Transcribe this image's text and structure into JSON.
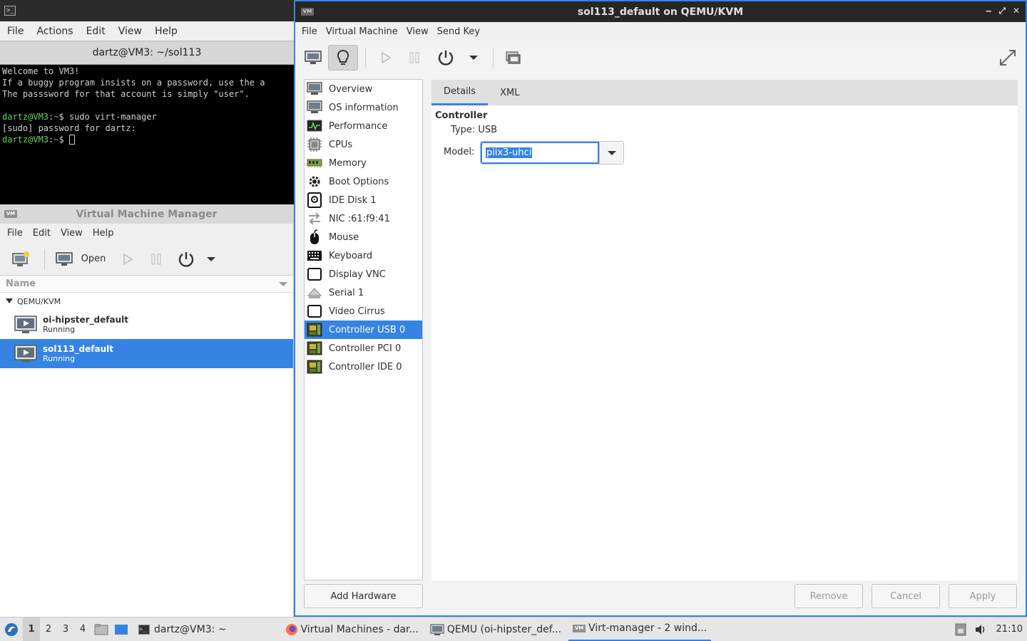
{
  "terminal": {
    "menu": [
      "File",
      "Actions",
      "Edit",
      "View",
      "Help"
    ],
    "tab_title": "dartz@VM3: ~/sol113",
    "lines": {
      "l1": "Welcome to VM3!",
      "l2": "If a buggy program insists on a password, use the a",
      "l3": "The passsword for that account is simply \"user\".",
      "prompt_user": "dartz@VM3",
      "prompt_sep": ":",
      "prompt_path": "~",
      "prompt_end": "$ ",
      "cmd1": "sudo virt-manager",
      "l5": "[sudo] password for dartz:"
    }
  },
  "vmm": {
    "title": "Virtual Machine Manager",
    "logo": "VM",
    "menu": [
      "File",
      "Edit",
      "View",
      "Help"
    ],
    "toolbar": {
      "open_label": "Open"
    },
    "column_name": "Name",
    "group": "QEMU/KVM",
    "vms": [
      {
        "name": "oi-hipster_default",
        "status": "Running"
      },
      {
        "name": "sol113_default",
        "status": "Running"
      }
    ]
  },
  "details": {
    "title": "sol113_default on QEMU/KVM",
    "menu": [
      "File",
      "Virtual Machine",
      "View",
      "Send Key"
    ],
    "hardware": [
      {
        "label": "Overview",
        "icon": "monitor-icon"
      },
      {
        "label": "OS information",
        "icon": "monitor-icon"
      },
      {
        "label": "Performance",
        "icon": "performance-icon"
      },
      {
        "label": "CPUs",
        "icon": "cpu-icon"
      },
      {
        "label": "Memory",
        "icon": "memory-icon"
      },
      {
        "label": "Boot Options",
        "icon": "gear-icon"
      },
      {
        "label": "IDE Disk 1",
        "icon": "disk-icon"
      },
      {
        "label": "NIC :61:f9:41",
        "icon": "network-icon"
      },
      {
        "label": "Mouse",
        "icon": "mouse-icon"
      },
      {
        "label": "Keyboard",
        "icon": "keyboard-icon"
      },
      {
        "label": "Display VNC",
        "icon": "display-icon"
      },
      {
        "label": "Serial 1",
        "icon": "serial-icon"
      },
      {
        "label": "Video Cirrus",
        "icon": "display-icon"
      },
      {
        "label": "Controller USB 0",
        "icon": "controller-icon"
      },
      {
        "label": "Controller PCI 0",
        "icon": "controller-icon"
      },
      {
        "label": "Controller IDE 0",
        "icon": "controller-icon"
      }
    ],
    "selected_index": 13,
    "tabs": [
      "Details",
      "XML"
    ],
    "section_title": "Controller",
    "type_label": "Type:",
    "type_value": "USB",
    "model_label": "Model:",
    "model_value": "piix3-uhci",
    "buttons": {
      "add_hardware": "Add Hardware",
      "remove": "Remove",
      "cancel": "Cancel",
      "apply": "Apply"
    }
  },
  "taskbar": {
    "workspaces": [
      "1",
      "2",
      "3",
      "4"
    ],
    "active_workspace": "1",
    "terminal_task": "dartz@VM3: ~",
    "tasks": [
      {
        "label": "Virtual Machines - dar...",
        "icon": "firefox-icon"
      },
      {
        "label": "QEMU (oi-hipster_def...",
        "icon": "monitor-icon"
      },
      {
        "label": "Virt-manager - 2 wind...",
        "icon": "virt-manager-icon"
      }
    ],
    "clock": "21:10",
    "colors": {
      "accent": "#3584e4"
    }
  }
}
